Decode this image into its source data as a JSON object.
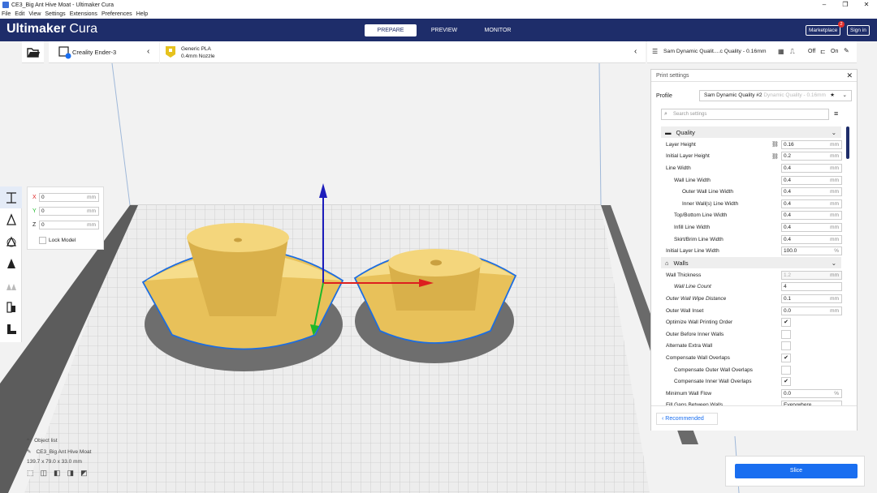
{
  "window": {
    "title": "CE3_Big Ant Hive Moat - Ultimaker Cura"
  },
  "menu": [
    "File",
    "Edit",
    "View",
    "Settings",
    "Extensions",
    "Preferences",
    "Help"
  ],
  "header": {
    "logo_bold": "Ultimaker",
    "logo_light": " Cura",
    "stages": [
      "PREPARE",
      "PREVIEW",
      "MONITOR"
    ],
    "marketplace": "Marketplace",
    "marketplace_badge": "2",
    "signin": "Sign in"
  },
  "toolbar": {
    "printer": "Creality Ender-3",
    "material": "Generic PLA",
    "nozzle": "0.4mm Nozzle",
    "profile_summary": "Sam Dynamic Qualit....c Quality - 0.16mm",
    "support": "Off",
    "adhesion": "On"
  },
  "move": {
    "x": "0",
    "y": "0",
    "z": "0",
    "unit": "mm",
    "lock_model": "Lock Model",
    "x_label": "X",
    "y_label": "Y",
    "z_label": "Z"
  },
  "print_settings": {
    "title": "Print settings",
    "profile_label": "Profile",
    "profile_value": "Sam Dynamic Quality #2",
    "profile_suffix": "Dynamic Quality - 0.16mm",
    "search_placeholder": "Search settings",
    "quality_cat": "Quality",
    "walls_cat": "Walls",
    "rows": [
      {
        "label": "Layer Height",
        "value": "0.16",
        "unit": "mm",
        "indent": 0,
        "type": "num",
        "link": true
      },
      {
        "label": "Initial Layer Height",
        "value": "0.2",
        "unit": "mm",
        "indent": 0,
        "type": "num",
        "link": true
      },
      {
        "label": "Line Width",
        "value": "0.4",
        "unit": "mm",
        "indent": 0,
        "type": "num"
      },
      {
        "label": "Wall Line Width",
        "value": "0.4",
        "unit": "mm",
        "indent": 1,
        "type": "num"
      },
      {
        "label": "Outer Wall Line Width",
        "value": "0.4",
        "unit": "mm",
        "indent": 2,
        "type": "num"
      },
      {
        "label": "Inner Wall(s) Line Width",
        "value": "0.4",
        "unit": "mm",
        "indent": 2,
        "type": "num"
      },
      {
        "label": "Top/Bottom Line Width",
        "value": "0.4",
        "unit": "mm",
        "indent": 1,
        "type": "num"
      },
      {
        "label": "Infill Line Width",
        "value": "0.4",
        "unit": "mm",
        "indent": 1,
        "type": "num"
      },
      {
        "label": "Skirt/Brim Line Width",
        "value": "0.4",
        "unit": "mm",
        "indent": 1,
        "type": "num"
      },
      {
        "label": "Initial Layer Line Width",
        "value": "100.0",
        "unit": "%",
        "indent": 0,
        "type": "num"
      }
    ],
    "wall_rows": [
      {
        "label": "Wall Thickness",
        "value": "1.2",
        "unit": "mm",
        "indent": 0,
        "type": "num",
        "disabled": true
      },
      {
        "label": "Wall Line Count",
        "value": "4",
        "unit": "",
        "indent": 1,
        "type": "num",
        "italic": true
      },
      {
        "label": "Outer Wall Wipe Distance",
        "value": "0.1",
        "unit": "mm",
        "indent": 0,
        "type": "num",
        "italic": true
      },
      {
        "label": "Outer Wall Inset",
        "value": "0.0",
        "unit": "mm",
        "indent": 0,
        "type": "num"
      },
      {
        "label": "Optimize Wall Printing Order",
        "value": "✔",
        "indent": 0,
        "type": "chk"
      },
      {
        "label": "Outer Before Inner Walls",
        "value": "",
        "indent": 0,
        "type": "chk"
      },
      {
        "label": "Alternate Extra Wall",
        "value": "",
        "indent": 0,
        "type": "chk"
      },
      {
        "label": "Compensate Wall Overlaps",
        "value": "✔",
        "indent": 0,
        "type": "chk"
      },
      {
        "label": "Compensate Outer Wall Overlaps",
        "value": "",
        "indent": 1,
        "type": "chk"
      },
      {
        "label": "Compensate Inner Wall Overlaps",
        "value": "✔",
        "indent": 1,
        "type": "chk"
      },
      {
        "label": "Minimum Wall Flow",
        "value": "0.0",
        "unit": "%",
        "indent": 0,
        "type": "num"
      },
      {
        "label": "Fill Gaps Between Walls",
        "value": "Everywhere",
        "unit": "",
        "indent": 0,
        "type": "num"
      }
    ],
    "recommended": "Recommended"
  },
  "object_list": {
    "label": "Object list",
    "name": "CE3_Big Ant Hive Moat",
    "dims": "139.7 x 79.0 x 33.0 mm"
  },
  "slice": {
    "label": "Slice"
  },
  "colors": {
    "header": "#1e2d6a",
    "accent": "#196ef0",
    "model": "#f4d276"
  }
}
